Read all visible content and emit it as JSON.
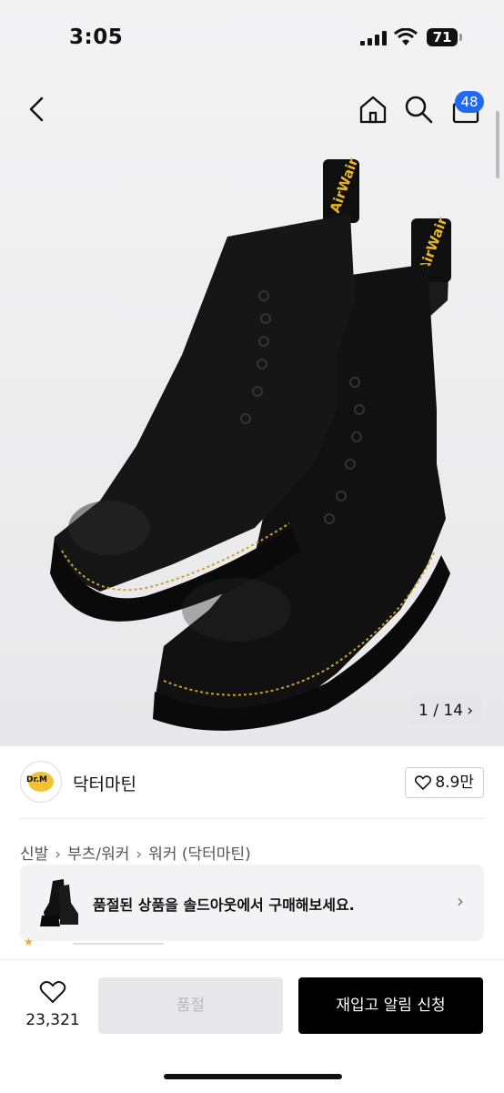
{
  "status_bar": {
    "time": "3:05",
    "battery": "71"
  },
  "header": {
    "cart_count": "48"
  },
  "gallery": {
    "counter": "1 / 14",
    "next_icon": "chevron-right-icon"
  },
  "brand": {
    "name": "닥터마틴",
    "likes": "8.9만"
  },
  "breadcrumb": {
    "items": [
      "신발",
      "부츠/워커",
      "워커 (닥터마틴)"
    ]
  },
  "soldout_banner": {
    "text": "품절된 상품을 솔드아웃에서 구매해보세요."
  },
  "bottom_bar": {
    "favorites_count": "23,321",
    "soldout_label": "품절",
    "restock_label": "재입고 알림 신청"
  },
  "colors": {
    "accent_blue": "#1e6af5",
    "primary_black": "#000000",
    "disabled_gray": "#e8e8ea"
  }
}
